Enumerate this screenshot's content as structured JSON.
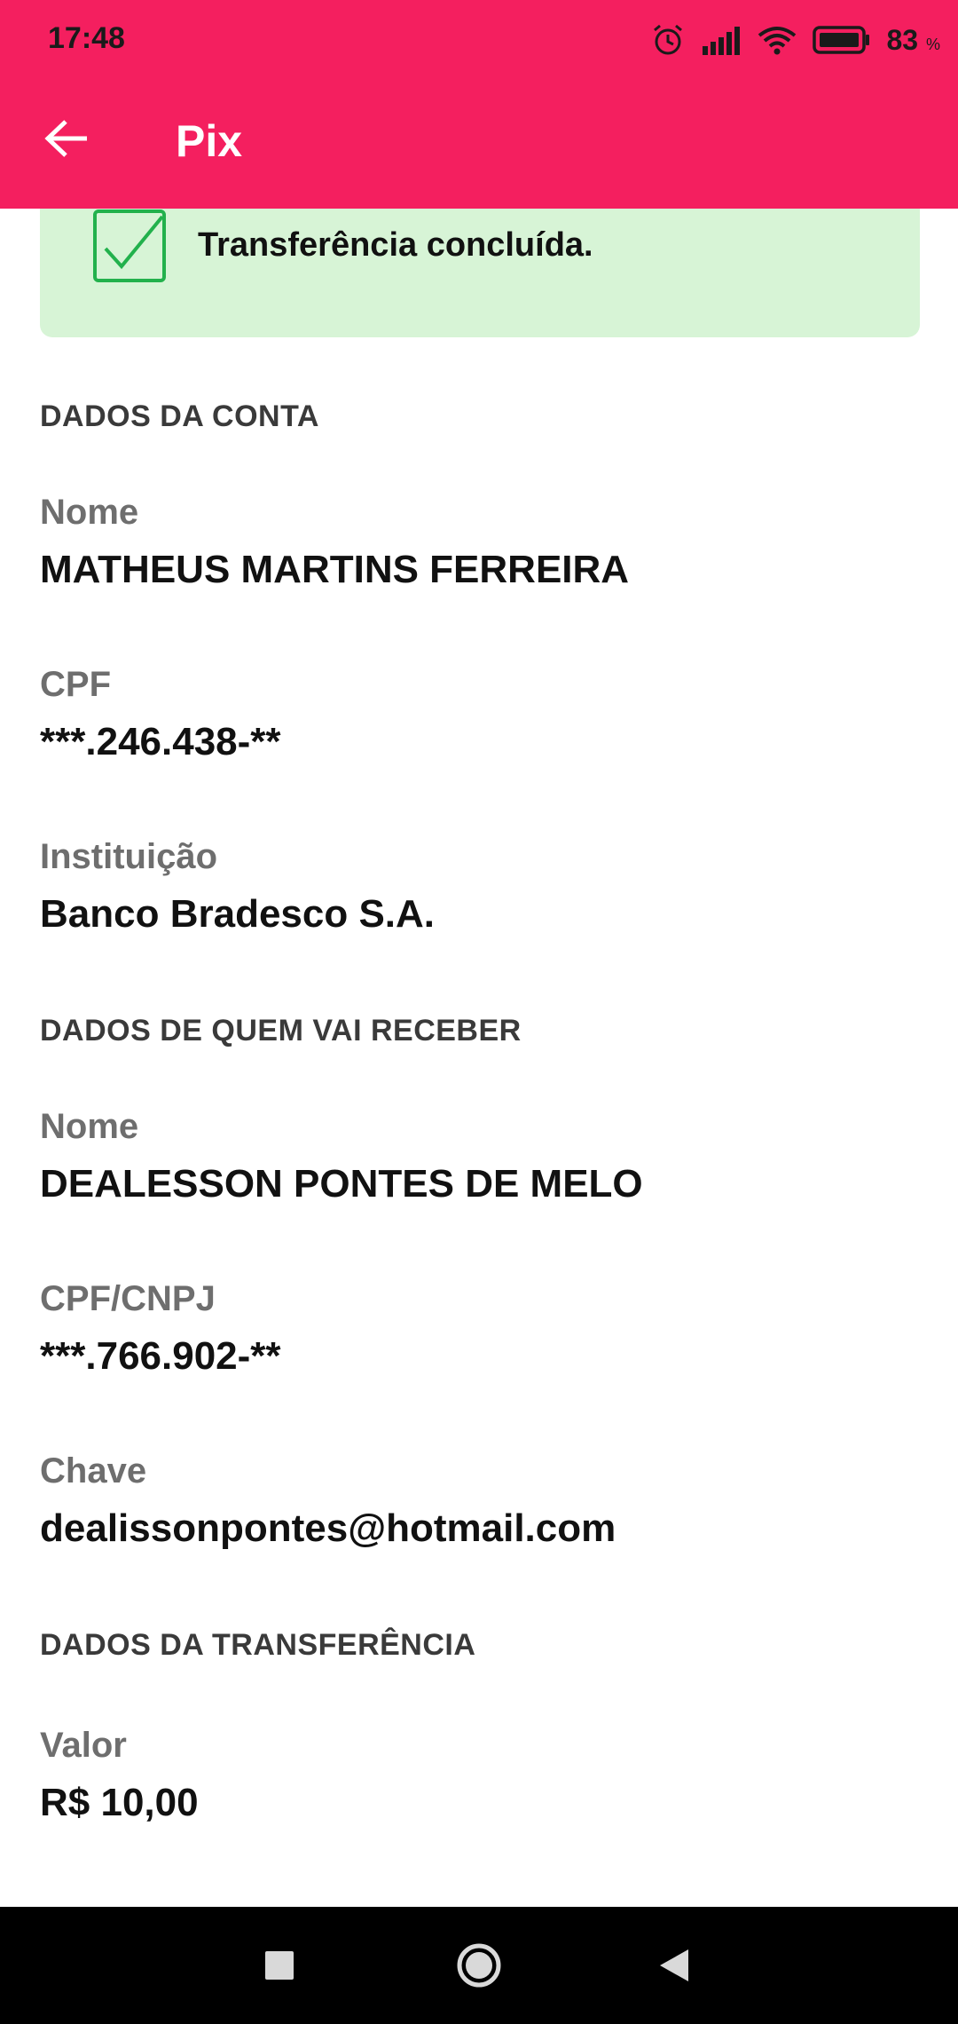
{
  "status_bar": {
    "time": "17:48",
    "battery_percent": "83",
    "battery_unit": "%",
    "icons": [
      "alarm-icon",
      "signal-icon",
      "wifi-icon",
      "battery-icon"
    ]
  },
  "header": {
    "title": "Pix",
    "back_icon": "arrow-left-icon",
    "background_color": "#f41f5f"
  },
  "banner": {
    "text": "Transferência concluída.",
    "icon": "checkbox-check-icon",
    "background_color": "#d7f4d6",
    "accent_color": "#22b14c"
  },
  "sections": {
    "account": {
      "title": "DADOS DA CONTA",
      "name_label": "Nome",
      "name_value": "MATHEUS MARTINS FERREIRA",
      "cpf_label": "CPF",
      "cpf_value": "***.246.438-**",
      "institution_label": "Instituição",
      "institution_value": "Banco Bradesco S.A."
    },
    "receiver": {
      "title": "DADOS DE QUEM VAI RECEBER",
      "name_label": "Nome",
      "name_value": "DEALESSON PONTES DE MELO",
      "doc_label": "CPF/CNPJ",
      "doc_value": "***.766.902-**",
      "key_label": "Chave",
      "key_value": "dealissonpontes@hotmail.com"
    },
    "transfer": {
      "title": "DADOS DA TRANSFERÊNCIA",
      "amount_label": "Valor",
      "amount_value": "R$ 10,00"
    }
  },
  "navigation_bar": {
    "buttons": [
      "square-recents-icon",
      "circle-home-icon",
      "triangle-back-icon"
    ]
  }
}
